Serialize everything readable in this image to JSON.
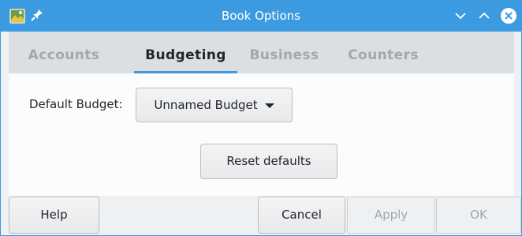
{
  "window": {
    "title": "Book Options",
    "accent_color": "#3c9be0"
  },
  "icons": {
    "app": "gnucash-app-icon",
    "pin": "pin-icon",
    "minimize": "chevron-down-icon",
    "maximize": "chevron-up-icon",
    "close": "close-icon"
  },
  "tabs": [
    {
      "label": "Accounts",
      "active": false
    },
    {
      "label": "Budgeting",
      "active": true
    },
    {
      "label": "Business",
      "active": false
    },
    {
      "label": "Counters",
      "active": false
    }
  ],
  "budgeting": {
    "default_budget_label": "Default Budget:",
    "default_budget_value": "Unnamed Budget",
    "reset_label": "Reset defaults"
  },
  "footer": {
    "help": "Help",
    "cancel": "Cancel",
    "apply": "Apply",
    "ok": "OK"
  }
}
